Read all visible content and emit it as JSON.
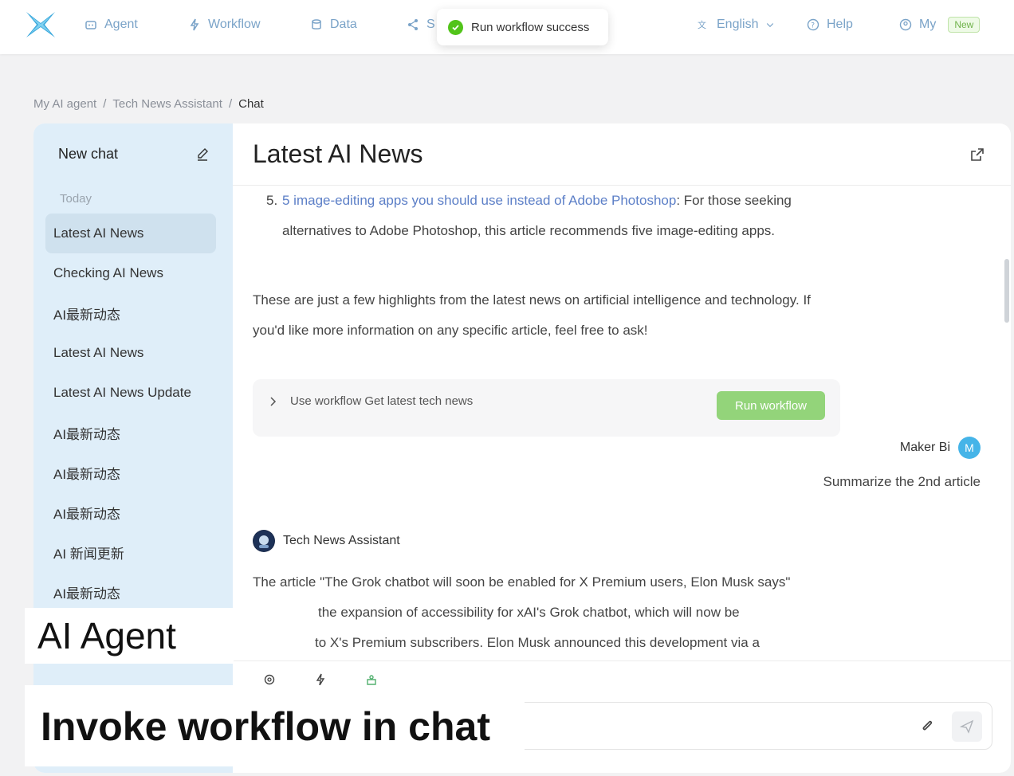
{
  "nav": {
    "items": [
      {
        "label": "Agent",
        "icon": "robot-icon"
      },
      {
        "label": "Workflow",
        "icon": "workflow-icon"
      },
      {
        "label": "Data",
        "icon": "database-icon"
      },
      {
        "label": "S",
        "icon": "share-icon"
      }
    ],
    "language": "English",
    "help": "Help",
    "my": "My",
    "new_badge": "New"
  },
  "toast": {
    "text": "Run workflow success"
  },
  "breadcrumb": [
    "My AI agent",
    "Tech News Assistant",
    "Chat"
  ],
  "sidebar": {
    "new_chat": "New chat",
    "section": "Today",
    "chats": [
      "Latest AI News",
      "Checking AI News",
      "AI最新动态",
      "Latest AI News",
      "Latest AI News Update",
      "AI最新动态",
      "AI最新动态",
      "AI最新动态",
      "AI 新闻更新",
      "AI最新动态"
    ]
  },
  "chat": {
    "title": "Latest AI News",
    "item_number": "5.",
    "item_link": "5 image-editing apps you should use instead of Adobe Photoshop",
    "item_text": ": For those seeking alternatives to Adobe Photoshop, this article recommends five image-editing apps.",
    "summary": "These are just a few highlights from the latest news on artificial intelligence and technology. If you'd like more information on any specific article, feel free to ask!",
    "workflow_text": "Use workflow Get latest tech news",
    "run_button": "Run workflow",
    "user_name": "Maker Bi",
    "user_initial": "M",
    "user_message": "Summarize the 2nd article",
    "bot_name": "Tech News Assistant",
    "bot_line1": "The article \"The Grok chatbot will soon be enabled for X Premium users, Elon Musk says\"",
    "bot_line2": "the expansion of accessibility for xAI's Grok chatbot, which will now be",
    "bot_line3": "to X's Premium subscribers. Elon Musk announced this development via a"
  },
  "captions": {
    "line1": "AI Agent",
    "line2": "Invoke workflow in chat"
  },
  "colors": {
    "accent": "#7aa3c8",
    "sidebar_bg": "#dfeef9",
    "run_button": "#93d47a",
    "success": "#52c41a"
  }
}
